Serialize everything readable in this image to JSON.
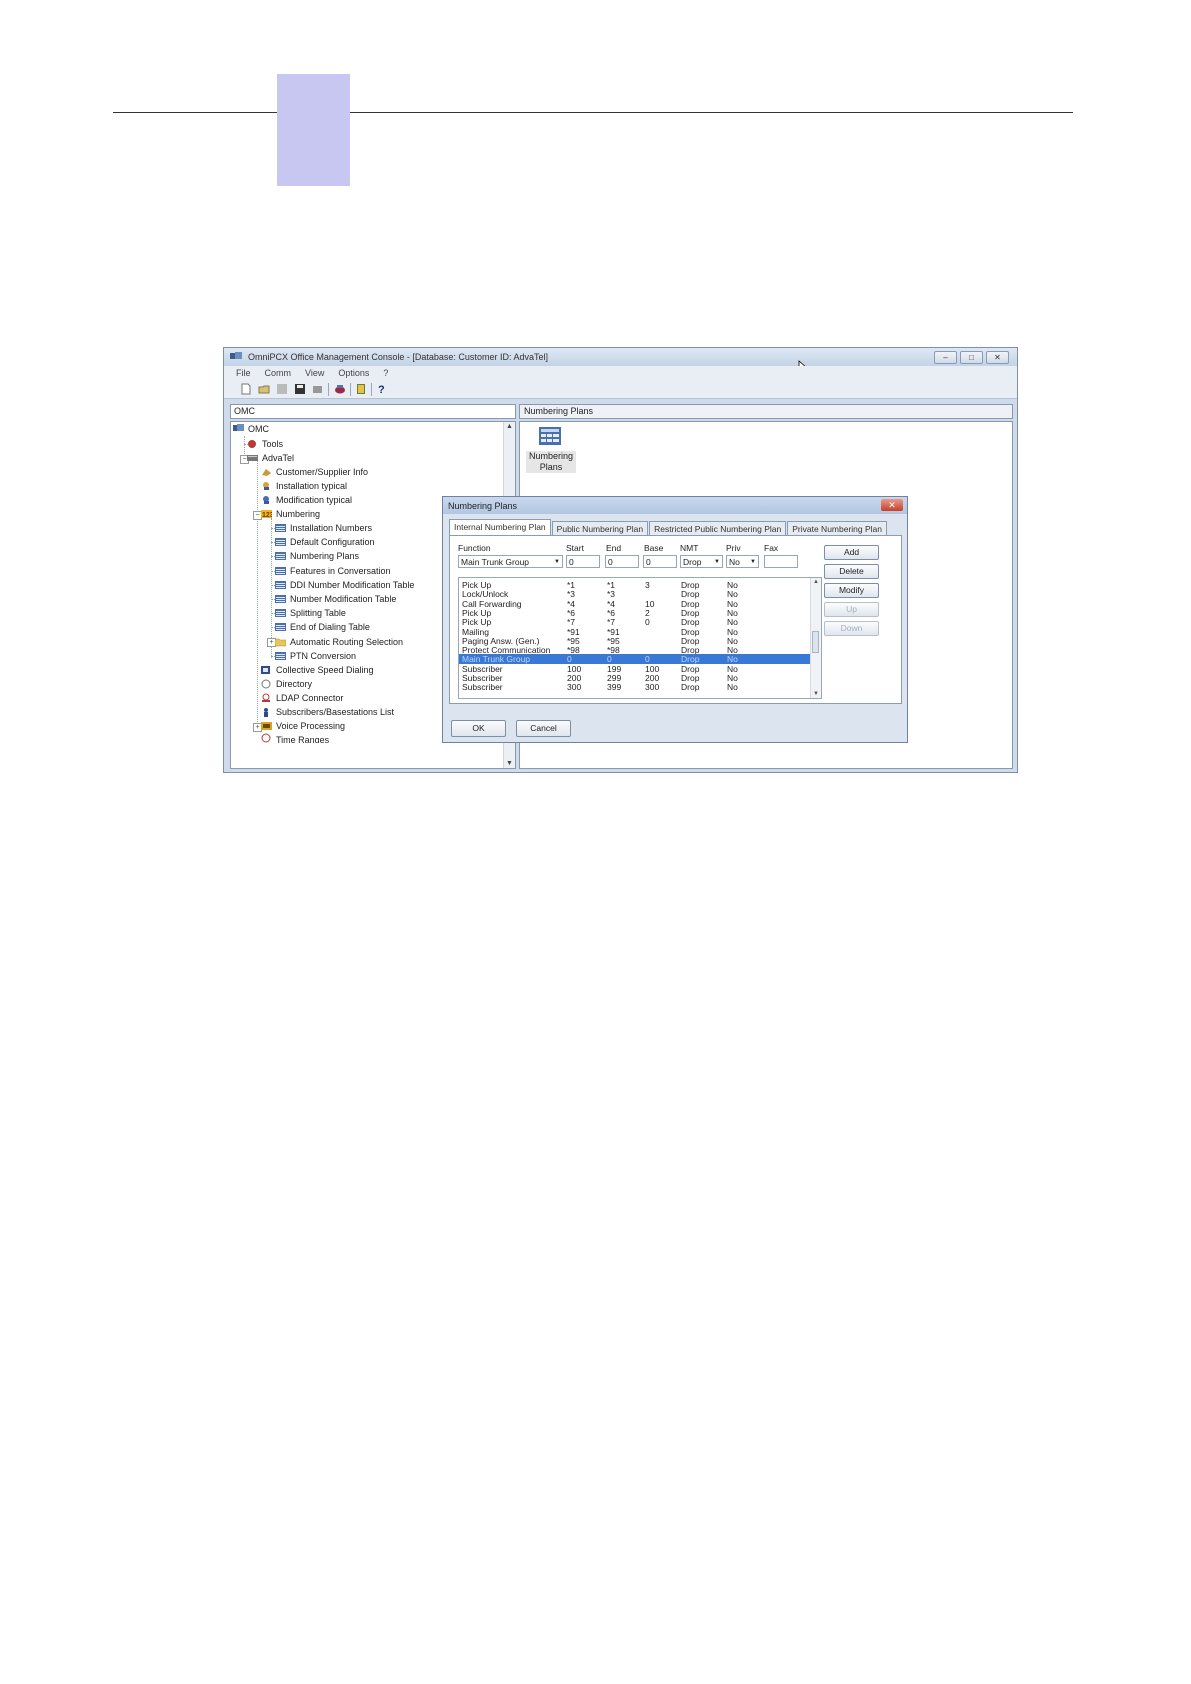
{
  "window": {
    "title": "OmniPCX Office Management Console - [Database:     Customer ID:  AdvaTel]",
    "controls": {
      "minimize": "‒",
      "maximize": "□",
      "close": "✕"
    }
  },
  "menu": [
    "File",
    "Comm",
    "View",
    "Options",
    "?"
  ],
  "left_header": "OMC",
  "right_header": "Numbering Plans",
  "tree": {
    "root": "OMC",
    "tools": "Tools",
    "site": "AdvaTel",
    "customer_info": "Customer/Supplier Info",
    "installation_typical": "Installation typical",
    "modification_typical": "Modification typical",
    "numbering": "Numbering",
    "numbering_children": [
      "Installation Numbers",
      "Default Configuration",
      "Numbering Plans",
      "Features in Conversation",
      "DDI Number Modification Table",
      "Number Modification Table",
      "Splitting Table",
      "End of Dialing Table",
      "Automatic Routing Selection",
      "PTN Conversion"
    ],
    "after_numbering": [
      "Collective Speed Dialing",
      "Directory",
      "LDAP Connector",
      "Subscribers/Basestations List",
      "Voice Processing",
      "Time Ranges"
    ]
  },
  "right_icon_label": "Numbering\nPlans",
  "dialog": {
    "title": "Numbering Plans",
    "close": "✕",
    "tabs": [
      "Internal Numbering Plan",
      "Public Numbering Plan",
      "Restricted Public Numbering Plan",
      "Private Numbering Plan"
    ],
    "columns": [
      "Function",
      "Start",
      "End",
      "Base",
      "NMT",
      "Priv",
      "Fax"
    ],
    "inputs": {
      "function": "Main Trunk Group",
      "start": "0",
      "end": "0",
      "base": "0",
      "nmt": "Drop",
      "priv": "No",
      "fax": ""
    },
    "rows": [
      {
        "function": "Pick Up",
        "start": "*1",
        "end": "*1",
        "base": "3",
        "nmt": "Drop",
        "priv": "No"
      },
      {
        "function": "Lock/Unlock",
        "start": "*3",
        "end": "*3",
        "base": "",
        "nmt": "Drop",
        "priv": "No"
      },
      {
        "function": "Call Forwarding",
        "start": "*4",
        "end": "*4",
        "base": "10",
        "nmt": "Drop",
        "priv": "No"
      },
      {
        "function": "Pick Up",
        "start": "*6",
        "end": "*6",
        "base": "2",
        "nmt": "Drop",
        "priv": "No"
      },
      {
        "function": "Pick Up",
        "start": "*7",
        "end": "*7",
        "base": "0",
        "nmt": "Drop",
        "priv": "No"
      },
      {
        "function": "Mailing",
        "start": "*91",
        "end": "*91",
        "base": "",
        "nmt": "Drop",
        "priv": "No"
      },
      {
        "function": "Paging Answ. (Gen.)",
        "start": "*95",
        "end": "*95",
        "base": "",
        "nmt": "Drop",
        "priv": "No"
      },
      {
        "function": "Protect Communication",
        "start": "*98",
        "end": "*98",
        "base": "",
        "nmt": "Drop",
        "priv": "No"
      },
      {
        "function": "Main Trunk Group",
        "start": "0",
        "end": "0",
        "base": "0",
        "nmt": "Drop",
        "priv": "No"
      },
      {
        "function": "Subscriber",
        "start": "100",
        "end": "199",
        "base": "100",
        "nmt": "Drop",
        "priv": "No"
      },
      {
        "function": "Subscriber",
        "start": "200",
        "end": "299",
        "base": "200",
        "nmt": "Drop",
        "priv": "No"
      },
      {
        "function": "Subscriber",
        "start": "300",
        "end": "399",
        "base": "300",
        "nmt": "Drop",
        "priv": "No"
      }
    ],
    "side_buttons": {
      "add": "Add",
      "delete": "Delete",
      "modify": "Modify",
      "up": "Up",
      "down": "Down"
    },
    "ok": "OK",
    "cancel": "Cancel"
  }
}
